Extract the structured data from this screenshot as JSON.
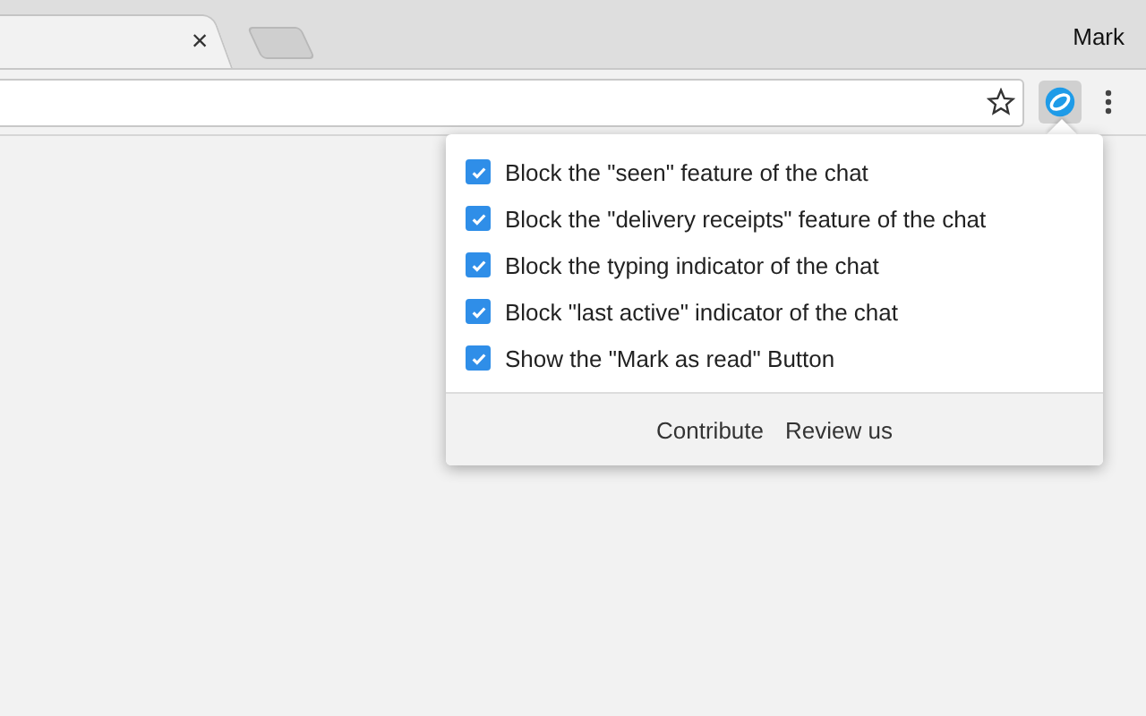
{
  "browser": {
    "profile": "Mark",
    "tab": {
      "close": "×"
    }
  },
  "popup": {
    "options": [
      {
        "label": "Block the \"seen\" feature of the chat",
        "checked": true
      },
      {
        "label": "Block the \"delivery receipts\" feature of the chat",
        "checked": true
      },
      {
        "label": "Block the typing indicator of the chat",
        "checked": true
      },
      {
        "label": "Block \"last active\" indicator of the chat",
        "checked": true
      },
      {
        "label": "Show the \"Mark as read\" Button",
        "checked": true
      }
    ],
    "links": [
      "Contribute",
      "Review us"
    ]
  }
}
